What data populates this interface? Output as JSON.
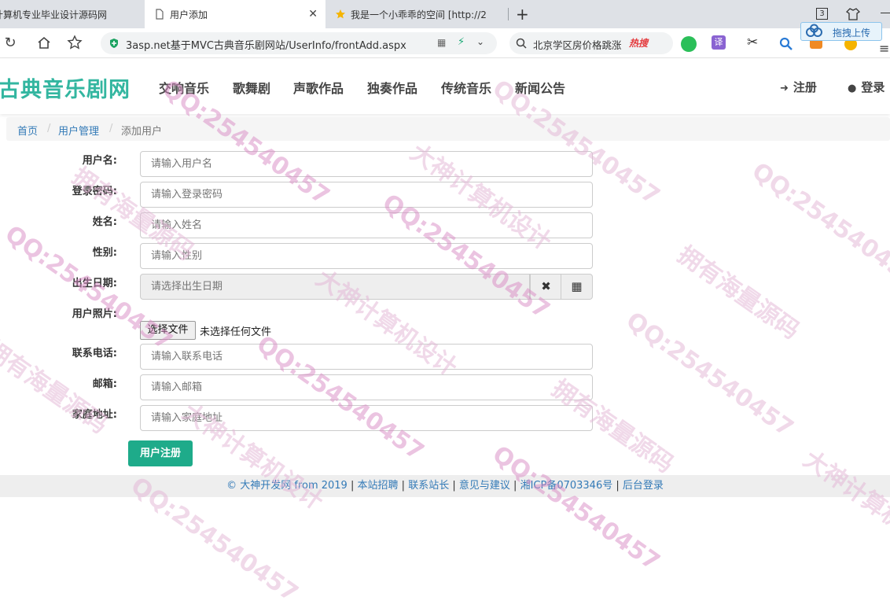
{
  "browser": {
    "tabs": [
      {
        "label": "计算机专业毕业设计源码网"
      },
      {
        "label": "用户添加"
      },
      {
        "label": "我是一个小乖乖的空间 [http://2"
      }
    ],
    "new_tab": "+",
    "tab_count_badge": "3",
    "url": "3asp.net基于MVC古典音乐剧网站/UserInfo/frontAdd.aspx",
    "search_text": "北京学区房价格跳涨",
    "search_hot": "热搜",
    "upload_label": "拖拽上传",
    "translate_glyph": "译"
  },
  "site": {
    "brand": "古典音乐剧网",
    "nav": [
      "交响音乐",
      "歌舞剧",
      "声歌作品",
      "独奏作品",
      "传统音乐",
      "新闻公告"
    ],
    "register_label": "注册",
    "login_label": "登录"
  },
  "breadcrumb": {
    "home": "首页",
    "section": "用户管理",
    "current": "添加用户",
    "sep": "/"
  },
  "form": {
    "fields": [
      {
        "label": "用户名:",
        "placeholder": "请输入用户名"
      },
      {
        "label": "登录密码:",
        "placeholder": "请输入登录密码"
      },
      {
        "label": "姓名:",
        "placeholder": "请输入姓名"
      },
      {
        "label": "性别:",
        "placeholder": "请输入性别"
      },
      {
        "label": "出生日期:",
        "placeholder": "请选择出生日期"
      },
      {
        "label": "用户照片:"
      },
      {
        "label": "联系电话:",
        "placeholder": "请输入联系电话"
      },
      {
        "label": "邮箱:",
        "placeholder": "请输入邮箱"
      },
      {
        "label": "家庭地址:",
        "placeholder": "请输入家庭地址"
      }
    ],
    "clear_glyph": "✖",
    "calendar_glyph": "▦",
    "file_button": "选择文件",
    "file_status": "未选择任何文件",
    "submit": "用户注册"
  },
  "footer": {
    "copyright": "© 大神开发网 from 2019",
    "links": [
      "本站招聘",
      "联系站长",
      "意见与建议",
      "湘ICP备0703346号",
      "后台登录"
    ],
    "sep": "|"
  },
  "watermarks": {
    "qq": "QQ:254540457",
    "dashen": "大神计算机设计",
    "haiyang": "拥有海量源码"
  }
}
